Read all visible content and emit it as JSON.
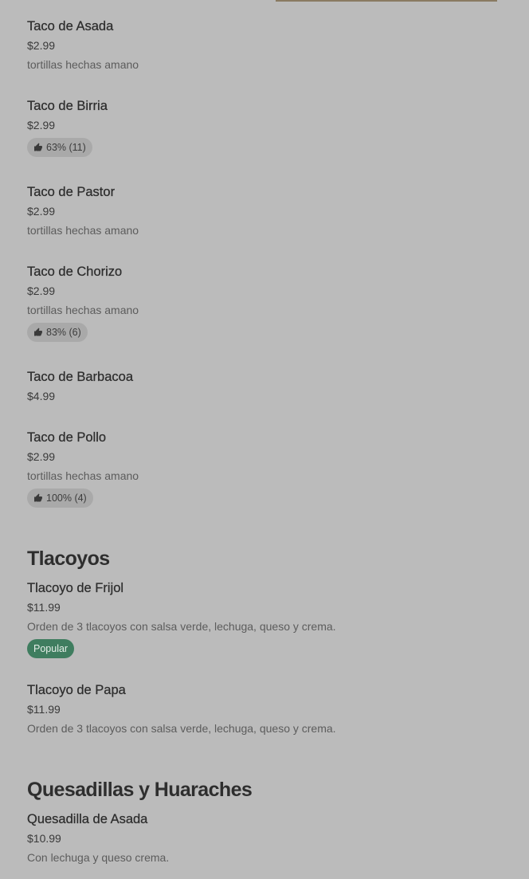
{
  "colors": {
    "background": "#bbbbbb",
    "popular_badge": "#3f7d5f",
    "rating_badge": "#a9a9a9"
  },
  "icons": {
    "rating": "thumbs-up-icon"
  },
  "tacos": [
    {
      "name": "Taco de Asada",
      "price": "$2.99",
      "description": "tortillas hechas amano"
    },
    {
      "name": "Taco de Birria",
      "price": "$2.99",
      "rating": "63% (11)"
    },
    {
      "name": "Taco de Pastor",
      "price": "$2.99",
      "description": "tortillas hechas amano"
    },
    {
      "name": "Taco de Chorizo",
      "price": "$2.99",
      "description": "tortillas hechas amano",
      "rating": "83% (6)"
    },
    {
      "name": "Taco de Barbacoa",
      "price": "$4.99"
    },
    {
      "name": "Taco de Pollo",
      "price": "$2.99",
      "description": "tortillas hechas amano",
      "rating": "100% (4)"
    }
  ],
  "tlacoyos": {
    "title": "Tlacoyos",
    "items": [
      {
        "name": "Tlacoyo de Frijol",
        "price": "$11.99",
        "description": "Orden de 3 tlacoyos con salsa verde, lechuga, queso y crema.",
        "badge": "Popular"
      },
      {
        "name": "Tlacoyo de Papa",
        "price": "$11.99",
        "description": "Orden de 3 tlacoyos con salsa verde, lechuga, queso y crema."
      }
    ]
  },
  "quesadillas": {
    "title": "Quesadillas y Huaraches",
    "items": [
      {
        "name": "Quesadilla de Asada",
        "price": "$10.99",
        "description": "Con lechuga y queso crema."
      }
    ]
  }
}
